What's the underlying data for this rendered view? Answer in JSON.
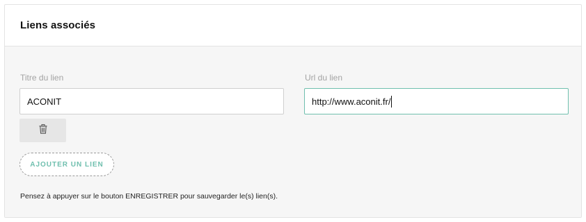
{
  "panel": {
    "title": "Liens associés"
  },
  "form": {
    "title_label": "Titre du lien",
    "title_value": "ACONIT",
    "url_label": "Url du lien",
    "url_value": "http://www.aconit.fr/",
    "delete_icon": "trash-icon",
    "add_button_label": "AJOUTER UN LIEN",
    "note": "Pensez à appuyer sur le bouton ENREGISTRER pour sauvegarder le(s) lien(s)."
  },
  "colors": {
    "accent": "#6fbfae",
    "label": "#a3a3a3",
    "body_bg": "#f6f6f6"
  }
}
